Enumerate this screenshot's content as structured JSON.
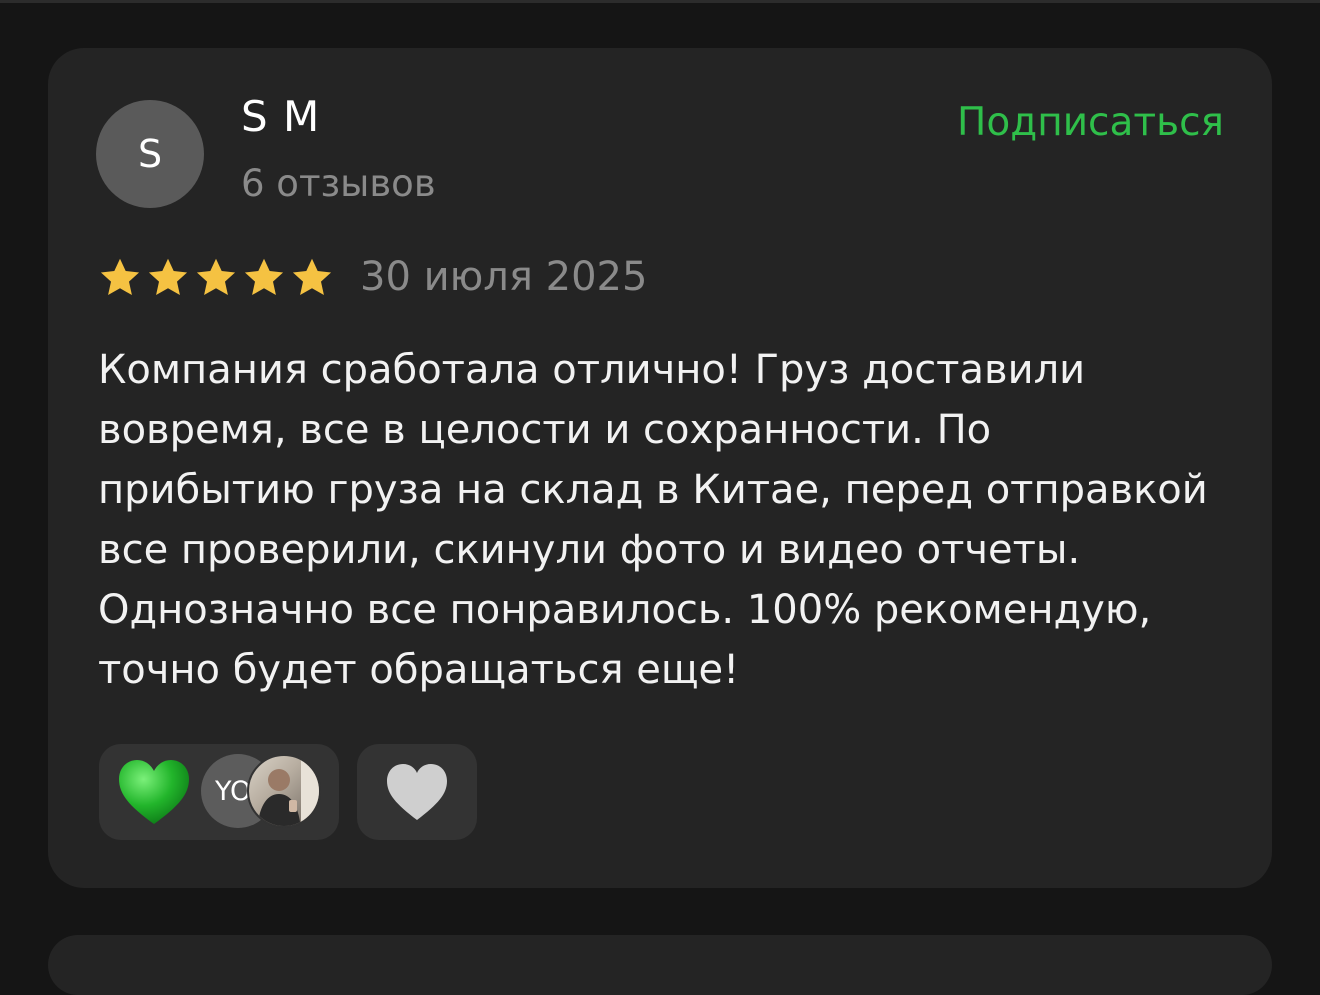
{
  "review": {
    "author": {
      "initial": "S",
      "name": "S M",
      "review_count": "6 отзывов"
    },
    "subscribe_label": "Подписаться",
    "rating": 5,
    "rating_max": 5,
    "date": "30 июля 2025",
    "text": "Компания сработала отлично! Груз доставили вовремя, все в целости и сохранности. По прибытию груза на склад в Китае, перед отправкой все проверили, скинули фото и видео отчеты. Однозначно все понравилось. 100% рекомендую, точно будет обращаться еще!",
    "reactions": {
      "emoji_icon": "green-heart-icon",
      "reactor_initials": "YO",
      "reactor_photo": "user-photo"
    },
    "like_icon": "heart-icon"
  },
  "colors": {
    "background": "#151515",
    "card": "#242424",
    "accent_green": "#2fbf4a",
    "star": "#f5c242",
    "muted_text": "#8a8a8a"
  }
}
